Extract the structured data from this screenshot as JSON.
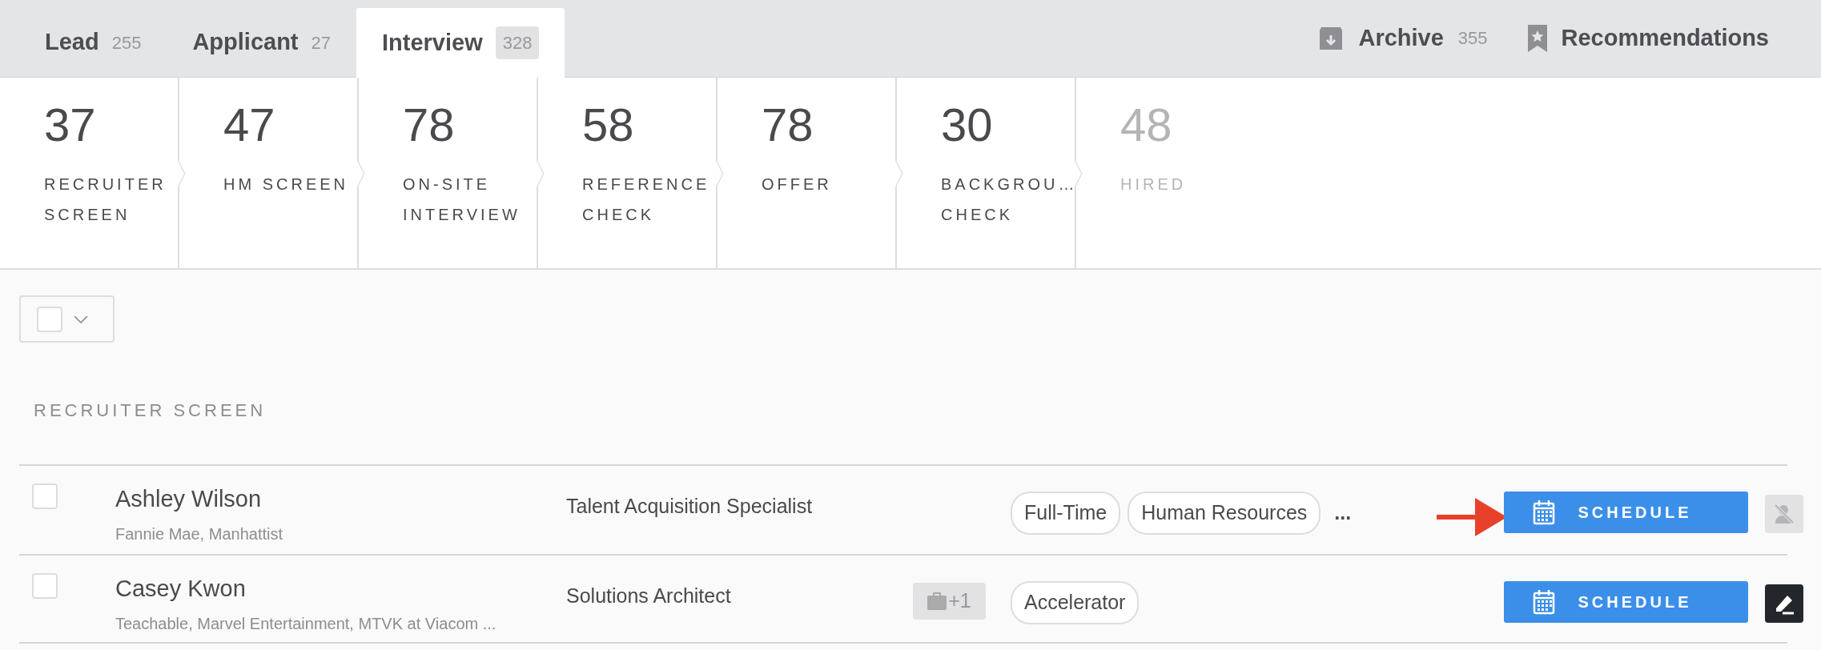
{
  "tabs": [
    {
      "label": "Lead",
      "count": "255",
      "selected": false
    },
    {
      "label": "Applicant",
      "count": "27",
      "selected": false
    },
    {
      "label": "Interview",
      "count": "328",
      "selected": true
    }
  ],
  "right_tabs": [
    {
      "kind": "archive",
      "label": "Archive",
      "count": "355"
    },
    {
      "kind": "recommendations",
      "label": "Recommendations"
    }
  ],
  "stages": [
    {
      "count": "37",
      "lines": [
        "RECRUITER",
        "SCREEN"
      ],
      "disabled": false
    },
    {
      "count": "47",
      "lines": [
        "HM SCREEN"
      ],
      "disabled": false
    },
    {
      "count": "78",
      "lines": [
        "ON-SITE",
        "INTERVIEW"
      ],
      "disabled": false
    },
    {
      "count": "58",
      "lines": [
        "REFERENCE",
        "CHECK"
      ],
      "disabled": false
    },
    {
      "count": "78",
      "lines": [
        "OFFER"
      ],
      "disabled": false
    },
    {
      "count": "30",
      "lines": [
        "BACKGROU…",
        "CHECK"
      ],
      "disabled": false
    },
    {
      "count": "48",
      "lines": [
        "HIRED"
      ],
      "disabled": true
    }
  ],
  "bulk_select": {
    "checked": false
  },
  "section_title": "RECRUITER SCREEN",
  "rows": [
    {
      "checked": false,
      "name": "Ashley Wilson",
      "companies": "Fannie Mae, Manhattist",
      "position": "Talent Acquisition Specialist",
      "tags": [
        "Full-Time",
        "Human Resources"
      ],
      "more_tags": "...",
      "schedule": "SCHEDULE",
      "action_button": {
        "disabled": true
      }
    },
    {
      "checked": false,
      "name": "Casey Kwon",
      "companies": "Teachable, Marvel Entertainment, MTVK at Viacom ...",
      "position": "Solutions Architect",
      "extra_positions": "+1",
      "tags": [
        "Accelerator"
      ],
      "schedule": "SCHEDULE",
      "action_button": {
        "disabled": false
      }
    }
  ]
}
